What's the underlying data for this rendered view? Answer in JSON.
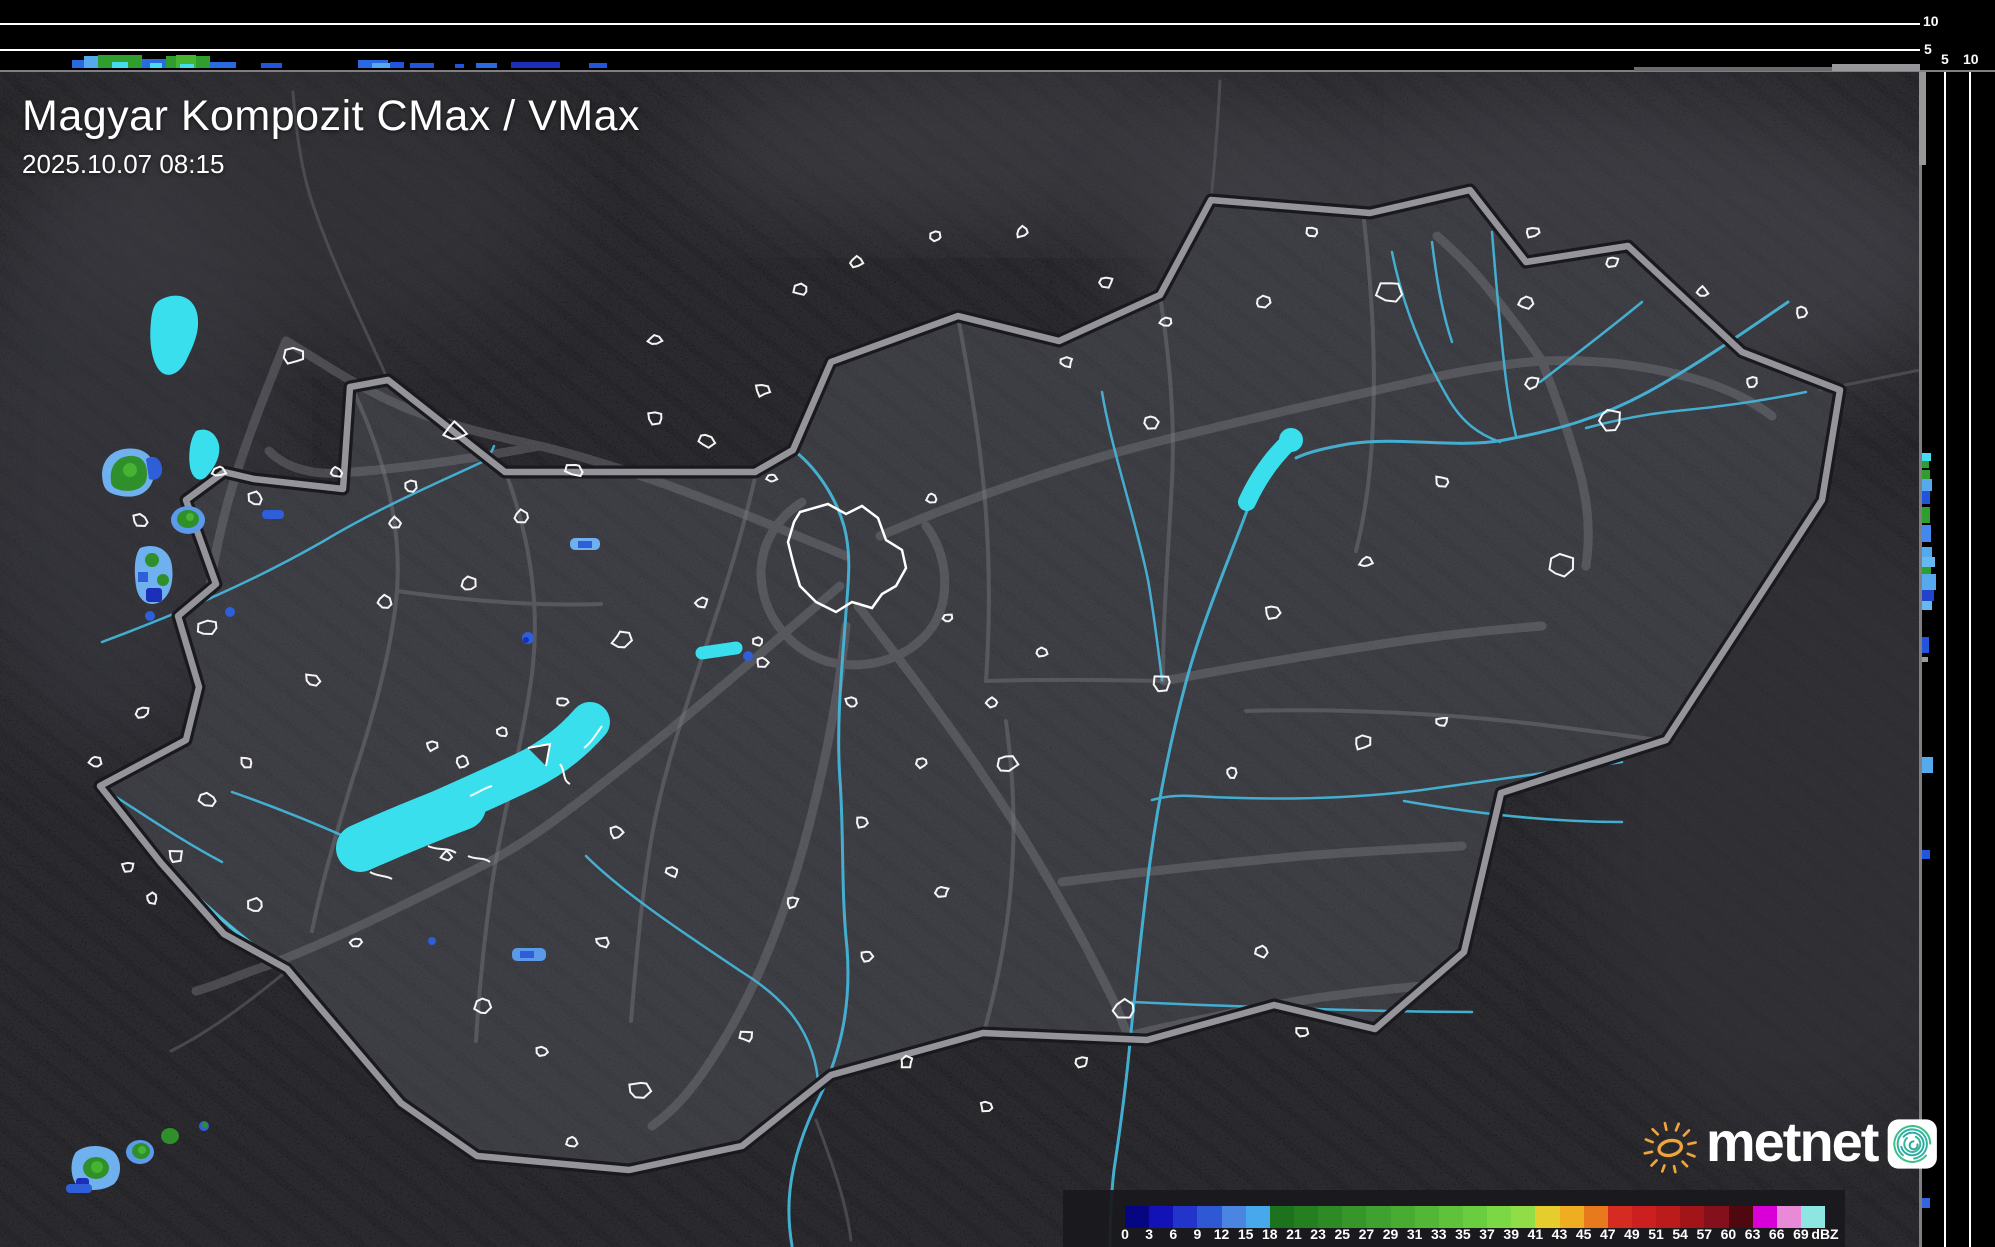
{
  "header": {
    "title": "Magyar Kompozit CMax / VMax",
    "timestamp": "2025.10.07 08:15"
  },
  "logo": {
    "text": "metnet"
  },
  "top_strip": {
    "axis_labels": [
      "10",
      "5"
    ]
  },
  "right_strip": {
    "axis_labels": [
      "5",
      "10"
    ]
  },
  "colorbar": {
    "unit": "dBZ",
    "ticks": [
      "0",
      "3",
      "6",
      "9",
      "12",
      "15",
      "18",
      "21",
      "23",
      "25",
      "27",
      "29",
      "31",
      "33",
      "35",
      "37",
      "39",
      "41",
      "43",
      "45",
      "47",
      "49",
      "51",
      "54",
      "57",
      "60",
      "63",
      "66",
      "69"
    ],
    "colors": [
      "#060683",
      "#1212b6",
      "#2334cb",
      "#2f58d5",
      "#4a86e1",
      "#47a9eb",
      "#1d731d",
      "#257e20",
      "#2e8a25",
      "#36962a",
      "#3fa12f",
      "#48ac33",
      "#52b737",
      "#5ec23b",
      "#6acd3f",
      "#7bd743",
      "#90dd48",
      "#e5cd2d",
      "#efae22",
      "#e87a1d",
      "#d62b21",
      "#cc2020",
      "#bb1b1b",
      "#a11417",
      "#83101b",
      "#4f080f",
      "#d800d6",
      "#e98ad9",
      "#8ee6e2"
    ]
  },
  "radar_activity": {
    "timeline_marks": [
      [
        72,
        30,
        8,
        "#2a6ae0"
      ],
      [
        84,
        14,
        12,
        "#55aaee"
      ],
      [
        98,
        44,
        13,
        "#2f9e2f"
      ],
      [
        112,
        16,
        6,
        "#44ddee"
      ],
      [
        142,
        24,
        9,
        "#2a6ae0"
      ],
      [
        150,
        12,
        5,
        "#44ddee"
      ],
      [
        166,
        44,
        12,
        "#2f9e2f"
      ],
      [
        176,
        20,
        13,
        "#46b332"
      ],
      [
        180,
        14,
        4,
        "#44ddee"
      ],
      [
        210,
        26,
        6,
        "#2a6ae0"
      ],
      [
        261,
        21,
        5,
        "#2255dd"
      ],
      [
        358,
        30,
        8,
        "#2a6ae0"
      ],
      [
        372,
        18,
        5,
        "#55aaee"
      ],
      [
        390,
        14,
        6,
        "#2255dd"
      ],
      [
        410,
        24,
        5,
        "#2255dd"
      ],
      [
        455,
        9,
        4,
        "#2255dd"
      ],
      [
        476,
        21,
        5,
        "#2a6ae0"
      ],
      [
        511,
        49,
        6,
        "#1b2fb8"
      ],
      [
        589,
        18,
        5,
        "#2255dd"
      ]
    ],
    "profile_marks": [
      [
        453,
        8,
        9,
        "#44ddee"
      ],
      [
        461,
        7,
        7,
        "#2f9e2f"
      ],
      [
        470,
        9,
        8,
        "#2f9e2f"
      ],
      [
        479,
        12,
        10,
        "#55aaee"
      ],
      [
        491,
        13,
        8,
        "#2255dd"
      ],
      [
        507,
        16,
        8,
        "#2f9e2f"
      ],
      [
        525,
        17,
        9,
        "#4488ee"
      ],
      [
        547,
        10,
        10,
        "#55aaee"
      ],
      [
        557,
        10,
        13,
        "#66b8f0"
      ],
      [
        567,
        7,
        9,
        "#2f9e2f"
      ],
      [
        574,
        16,
        14,
        "#55aaee"
      ],
      [
        590,
        11,
        12,
        "#2244cc"
      ],
      [
        601,
        9,
        10,
        "#66b8f0"
      ],
      [
        637,
        16,
        7,
        "#2255dd"
      ],
      [
        657,
        5,
        6,
        "#9a9a9a"
      ],
      [
        757,
        16,
        11,
        "#55aaee"
      ],
      [
        850,
        9,
        8,
        "#2255dd"
      ],
      [
        1198,
        10,
        8,
        "#3366dd"
      ]
    ]
  },
  "map_colors": {
    "water": "#3adfee",
    "river": "#46b5d8",
    "country_border": "#94949a",
    "city_outline": "#ffffff",
    "echo_green": "#2f8f2a",
    "echo_bright_green": "#46b332",
    "echo_blue": "#2e5fd8",
    "echo_light_blue": "#6fb0ee",
    "echo_dark_blue": "#1b2fb8"
  }
}
